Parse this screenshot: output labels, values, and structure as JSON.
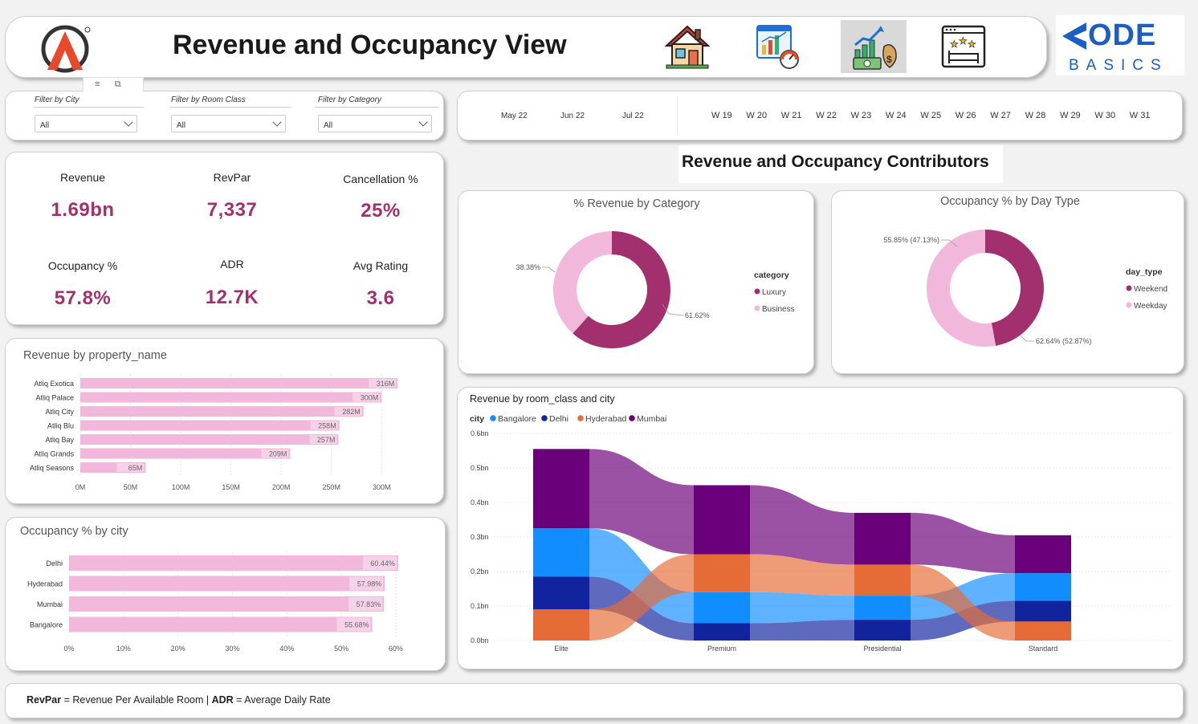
{
  "header": {
    "title": "Revenue and Occupancy View",
    "nav_icons": [
      "house-icon",
      "analytics-dashboard-icon",
      "revenue-growth-icon",
      "hotel-rating-icon"
    ],
    "brand": {
      "big": "ODE",
      "small": "BASICS"
    }
  },
  "filters": [
    {
      "label": "Filter by City",
      "value": "All"
    },
    {
      "label": "Filter by Room Class",
      "value": "All"
    },
    {
      "label": "Filter by Category",
      "value": "All"
    }
  ],
  "date_slicer": {
    "months": [
      "May 22",
      "Jun 22",
      "Jul 22"
    ],
    "weeks": [
      "W 19",
      "W 20",
      "W 21",
      "W 22",
      "W 23",
      "W 24",
      "W 25",
      "W 26",
      "W 27",
      "W 28",
      "W 29",
      "W 30",
      "W 31"
    ]
  },
  "kpis": [
    {
      "label": "Revenue",
      "value": "1.69bn"
    },
    {
      "label": "RevPar",
      "value": "7,337"
    },
    {
      "label": "Cancellation %",
      "value": "25%"
    },
    {
      "label": "Occupancy %",
      "value": "57.8%"
    },
    {
      "label": "ADR",
      "value": "12.7K"
    },
    {
      "label": "Avg Rating",
      "value": "3.6"
    }
  ],
  "section_title": "Revenue and Occupancy Contributors",
  "footer": {
    "term1": "RevPar",
    "def1": " = Revenue Per Available Room | ",
    "term2": "ADR",
    "def2": " = Average Daily Rate"
  },
  "colors": {
    "accent": "#a3306e",
    "pink": "#f2b8dc",
    "luxury": "#a3306e",
    "business": "#f2b8dc",
    "bangalore": "#118dff",
    "delhi": "#12239e",
    "hyderabad": "#e66c37",
    "mumbai": "#6b007b"
  },
  "chart_data": [
    {
      "id": "revenue_by_property",
      "type": "bar",
      "orientation": "horizontal",
      "title": "Revenue by property_name",
      "categories": [
        "Atliq Exotica",
        "Atliq Palace",
        "Atliq City",
        "Atliq Blu",
        "Atliq Bay",
        "Atliq Grands",
        "Atliq Seasons"
      ],
      "values": [
        316,
        300,
        282,
        258,
        257,
        209,
        65
      ],
      "labels": [
        "316M",
        "300M",
        "282M",
        "258M",
        "257M",
        "209M",
        "65M"
      ],
      "xticks": [
        "0M",
        "50M",
        "100M",
        "150M",
        "200M",
        "250M",
        "300M"
      ],
      "xlim": [
        0,
        325
      ]
    },
    {
      "id": "occupancy_by_city",
      "type": "bar",
      "orientation": "horizontal",
      "title": "Occupancy % by city",
      "categories": [
        "Delhi",
        "Hyderabad",
        "Mumbai",
        "Bangalore"
      ],
      "values": [
        60.44,
        57.98,
        57.83,
        55.68
      ],
      "labels": [
        "60.44%",
        "57.98%",
        "57.83%",
        "55.68%"
      ],
      "xticks": [
        "0%",
        "10%",
        "20%",
        "30%",
        "40%",
        "50%",
        "60%"
      ],
      "xlim": [
        0,
        62
      ]
    },
    {
      "id": "revenue_by_category",
      "type": "pie",
      "title": "% Revenue by Category",
      "legend_title": "category",
      "slices": [
        {
          "name": "Luxury",
          "value": 61.62,
          "label": "61.62%"
        },
        {
          "name": "Business",
          "value": 38.38,
          "label": "38.38%"
        }
      ]
    },
    {
      "id": "occupancy_by_day_type",
      "type": "pie",
      "title": "Occupancy % by Day Type",
      "legend_title": "day_type",
      "slices": [
        {
          "name": "Weekend",
          "value": 47.13,
          "label": "62.64% (52.87%)"
        },
        {
          "name": "Weekday",
          "value": 52.87,
          "label": "55.85% (47.13%)"
        }
      ]
    },
    {
      "id": "revenue_by_room_class_city",
      "type": "area",
      "subtype": "ribbon",
      "title": "Revenue by room_class and city",
      "legend_title": "city",
      "categories": [
        "Elite",
        "Premium",
        "Presidential",
        "Standard"
      ],
      "yticks": [
        "0.0bn",
        "0.1bn",
        "0.2bn",
        "0.3bn",
        "0.4bn",
        "0.5bn",
        "0.6bn"
      ],
      "ylim": [
        0,
        0.6
      ],
      "series": [
        {
          "name": "Bangalore",
          "values": [
            0.14,
            0.09,
            0.07,
            0.08
          ]
        },
        {
          "name": "Delhi",
          "values": [
            0.095,
            0.05,
            0.06,
            0.06
          ]
        },
        {
          "name": "Hyderabad",
          "values": [
            0.09,
            0.11,
            0.09,
            0.055
          ]
        },
        {
          "name": "Mumbai",
          "values": [
            0.23,
            0.2,
            0.15,
            0.11
          ]
        }
      ]
    }
  ]
}
